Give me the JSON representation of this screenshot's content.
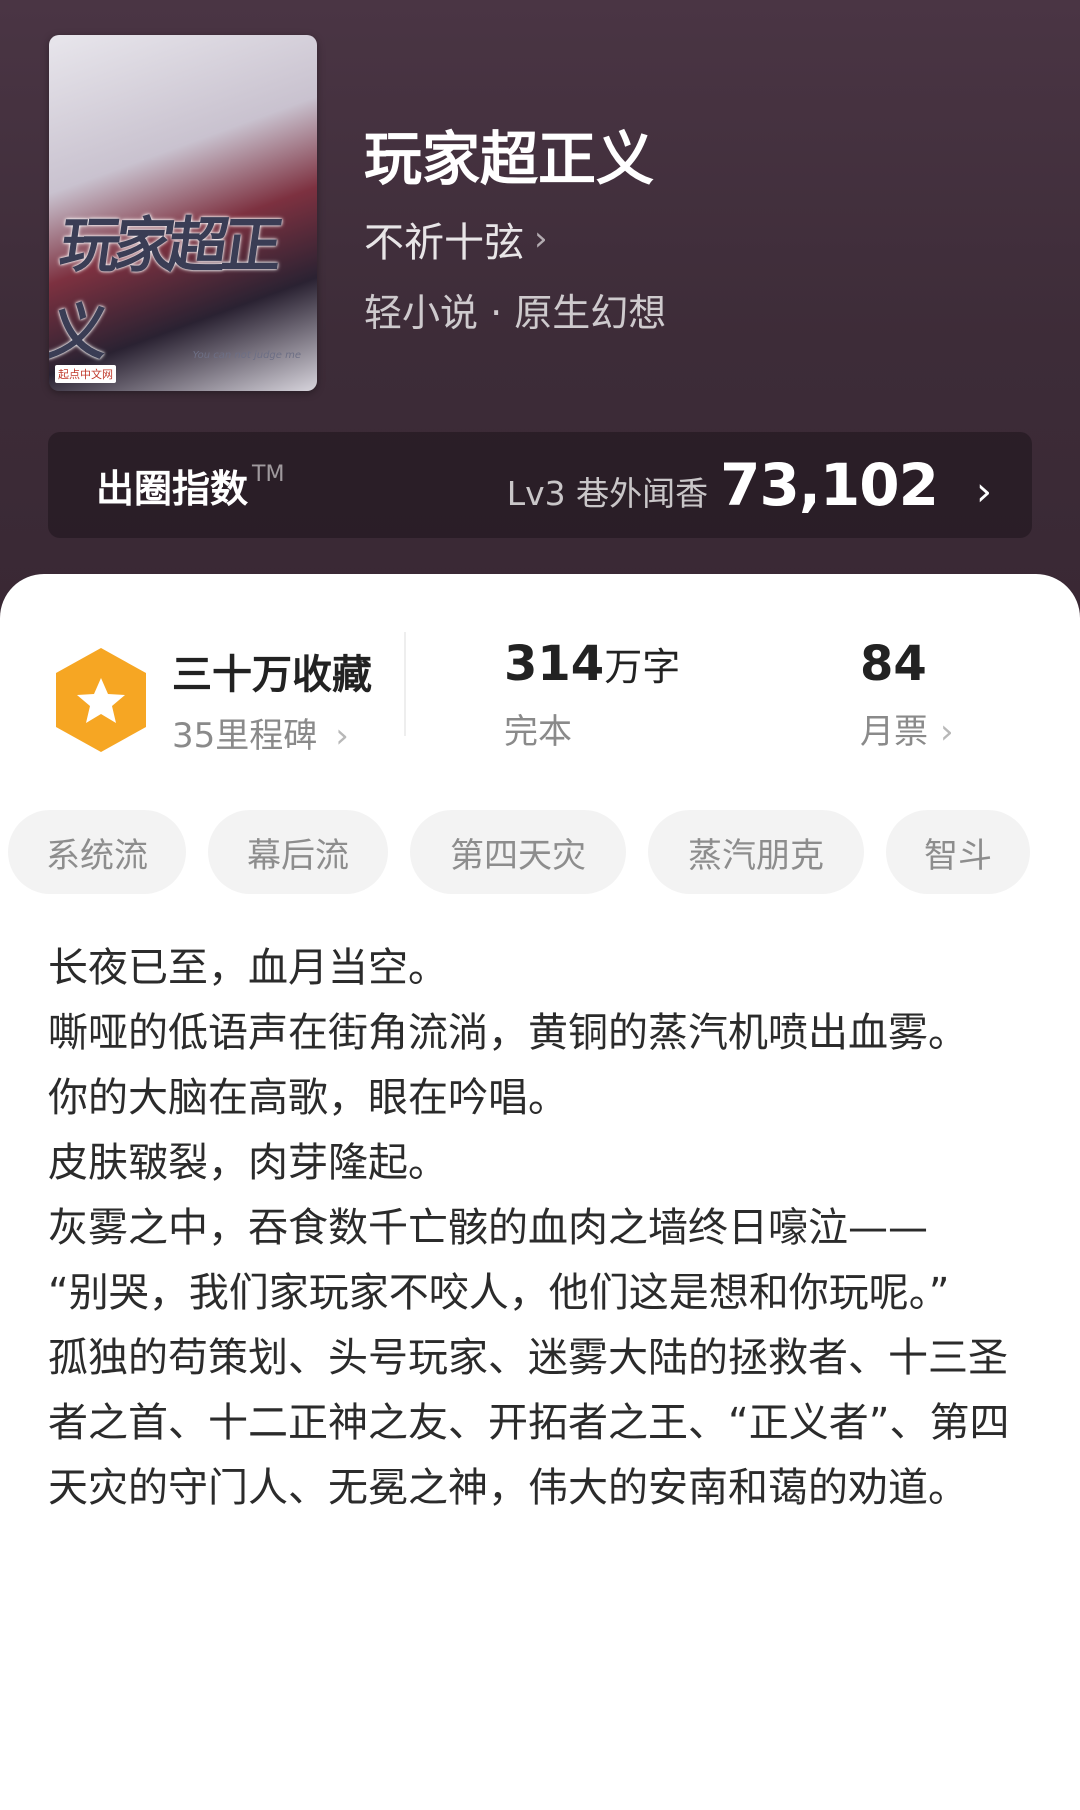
{
  "book": {
    "title": "玩家超正义",
    "author": "不祈十弦",
    "genre": "轻小说 · 原生幻想",
    "cover": {
      "title_text": "玩家超正义",
      "publisher": "起点中文网",
      "subtitle": "You can not judge me"
    }
  },
  "influence": {
    "label": "出圈指数",
    "tm": "TM",
    "level": "Lv3 巷外闻香",
    "score": "73,102"
  },
  "stats": {
    "collection": {
      "title": "三十万收藏",
      "sub": "35里程碑"
    },
    "words": {
      "value": "314",
      "unit": "万字",
      "status": "完本"
    },
    "votes": {
      "value": "84",
      "label": "月票"
    }
  },
  "tags": [
    "系统流",
    "幕后流",
    "第四天灾",
    "蒸汽朋克",
    "智斗"
  ],
  "description": [
    "长夜已至，血月当空。",
    "嘶哑的低语声在街角流淌，黄铜的蒸汽机喷出血雾。",
    "你的大脑在高歌，眼在吟唱。",
    "皮肤皲裂，肉芽隆起。",
    "灰雾之中，吞食数千亡骸的血肉之墙终日嚎泣——",
    "“别哭，我们家玩家不咬人，他们这是想和你玩呢。”",
    "孤独的苟策划、头号玩家、迷雾大陆的拯救者、十三圣者之首、十二正神之友、开拓者之王、“正义者”、第四天灾的守门人、无冕之神，伟大的安南和蔼的劝道。"
  ],
  "icons": {
    "chevron": "›",
    "star_badge": "star-hexagon-icon"
  },
  "colors": {
    "header_bg": "#3d2c38",
    "badge": "#f6a623"
  }
}
